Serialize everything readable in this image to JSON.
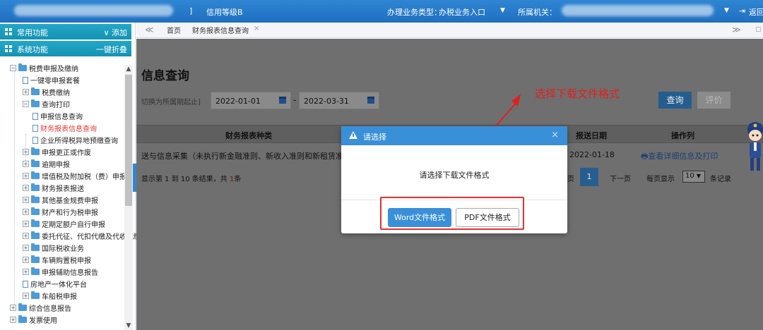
{
  "topbar": {
    "bracket": "]",
    "credit_level": "信用等级B",
    "business_type_label": "办理业务类型：",
    "business_type_value": "办税业务入口",
    "authority_label": "所属机关：",
    "return_label": "返回"
  },
  "sidebar": {
    "common_label": "常用功能",
    "common_action": "∨ 添加",
    "system_label": "系统功能",
    "system_action": "一键折叠",
    "tree": [
      {
        "label": "税费申报及缴纳"
      },
      {
        "label": "一键零申报套餐"
      },
      {
        "label": "税费缴纳"
      },
      {
        "label": "查询打印"
      },
      {
        "label": "申报信息查询"
      },
      {
        "label": "财务报表信息查询"
      },
      {
        "label": "企业所得税异地预缴查询"
      },
      {
        "label": "申报更正或作废"
      },
      {
        "label": "逾期申报"
      },
      {
        "label": "增值税及附加税（费）申报"
      },
      {
        "label": "财务报表报送"
      },
      {
        "label": "其他基金规费申报"
      },
      {
        "label": "财产和行为税申报"
      },
      {
        "label": "定期定额户自行申报"
      },
      {
        "label": "委托代征、代扣代缴及代收代缴"
      },
      {
        "label": "国际税收业务"
      },
      {
        "label": "车辆购置税申报"
      },
      {
        "label": "申报辅助信息报告"
      },
      {
        "label": "房地产一体化平台"
      },
      {
        "label": "车船税申报"
      },
      {
        "label": "综合信息报告"
      },
      {
        "label": "发票使用"
      }
    ]
  },
  "tabbar": {
    "back": "≪",
    "home": "首页",
    "current_tab": "财务报表信息查询",
    "close": "×",
    "forward": "≫"
  },
  "content": {
    "title": "信息查询",
    "hint": "切换为所属期起止]",
    "date_start": "2022-01-01",
    "date_sep": "-",
    "date_end": "2022-03-31",
    "query_btn": "查询",
    "evaluate_btn": "评价",
    "headers": [
      "财务报表种类",
      "报送日期",
      "操作列"
    ],
    "row": {
      "type": "送与信息采集（未执行新金融准则、新收入准则和新租赁准",
      "date": "2022-01-18",
      "action": "查看详细信息及打印"
    },
    "footer_summary_pre": "显示第 1 到 10 条结果，共 ",
    "footer_total": "1",
    "footer_summary_post": "条",
    "page_prev": "页",
    "page_current": "1",
    "page_next": "下一页",
    "per_page_pre": "每页显示",
    "per_page_value": "10",
    "per_page_post": "条记录"
  },
  "annotation": "选择下载文件格式",
  "modal": {
    "title": "请选择",
    "close": "×",
    "message": "请选择下载文件格式",
    "word_btn": "Word文件格式",
    "pdf_btn": "PDF文件格式"
  },
  "colors": {
    "primary": "#3a8fd9",
    "annotation_red": "#e02020",
    "sidebar_header": "#1593b3"
  }
}
